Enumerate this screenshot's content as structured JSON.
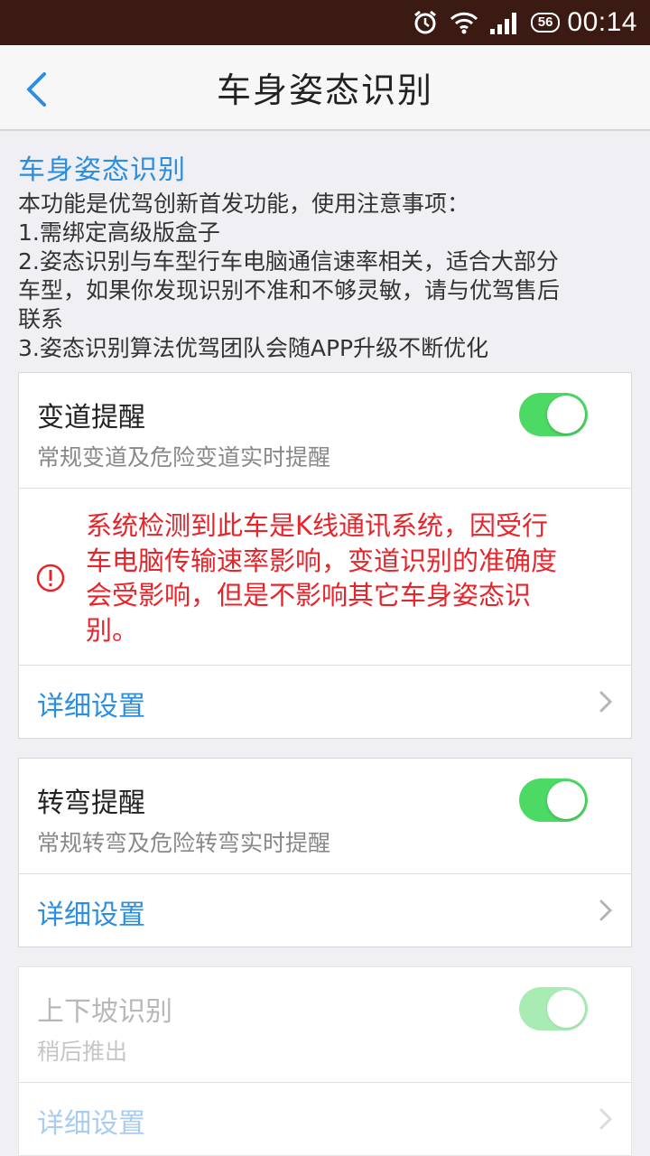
{
  "status_bar": {
    "network": "56",
    "time": "00:14",
    "icons": [
      "alarm-icon",
      "wifi-icon",
      "signal-icon"
    ]
  },
  "nav": {
    "title": "车身姿态识别",
    "back_icon": "chevron-left-icon"
  },
  "intro": {
    "title": "车身姿态识别",
    "lines": [
      "本功能是优驾创新首发功能，使用注意事项：",
      "1.需绑定高级版盒子",
      "2.姿态识别与车型行车电脑通信速率相关，适合大部分",
      "车型，如果你发现识别不准和不够灵敏，请与优驾售后",
      "联系",
      "3.姿态识别算法优驾团队会随APP升级不断优化"
    ]
  },
  "cards": [
    {
      "title": "变道提醒",
      "subtitle": "常规变道及危险变道实时提醒",
      "enabled": true,
      "warning": {
        "lines": [
          "系统检测到此车是K线通讯系统，因受行",
          "车电脑传输速率影响，变道识别的准确度",
          "会受影响，但是不影响其它车身姿态识",
          "别。"
        ],
        "icon": "alert-circle-icon"
      },
      "detail_label": "详细设置"
    },
    {
      "title": "转弯提醒",
      "subtitle": "常规转弯及危险转弯实时提醒",
      "enabled": true,
      "detail_label": "详细设置"
    },
    {
      "title": "上下坡识别",
      "subtitle": "稍后推出",
      "enabled": true,
      "disabled": true,
      "detail_label": "详细设置"
    }
  ],
  "colors": {
    "accent": "#2b8ee0",
    "warning": "#e8242b",
    "switch_on": "#4cd964",
    "status_bar_bg": "#3a1a12"
  }
}
